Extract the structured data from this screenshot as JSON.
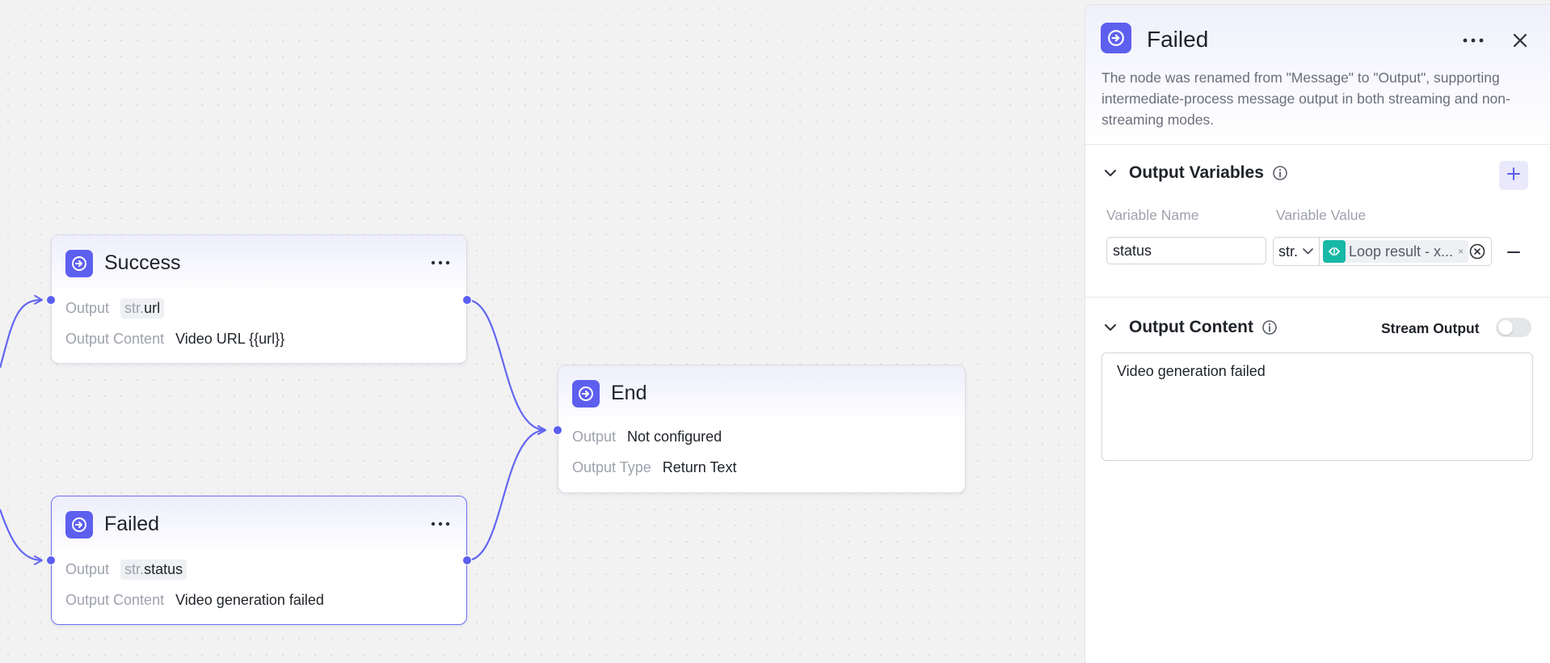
{
  "nodes": {
    "success": {
      "title": "Success",
      "output_label": "Output",
      "output_tag_prefix": "str.",
      "output_tag_name": "url",
      "content_label": "Output Content",
      "content_value": "Video URL {{url}}"
    },
    "failed": {
      "title": "Failed",
      "output_label": "Output",
      "output_tag_prefix": "str.",
      "output_tag_name": "status",
      "content_label": "Output Content",
      "content_value": "Video generation failed"
    },
    "end": {
      "title": "End",
      "output_label": "Output",
      "output_value": "Not configured",
      "type_label": "Output Type",
      "type_value": "Return Text"
    }
  },
  "panel": {
    "title": "Failed",
    "description": "The node was renamed from \"Message\" to \"Output\", supporting intermediate-process message output in both streaming and non-streaming modes.",
    "output_variables": {
      "heading": "Output Variables",
      "col_name": "Variable Name",
      "col_value": "Variable Value",
      "rows": [
        {
          "name": "status",
          "type": "str.",
          "ref": "Loop result - x..."
        }
      ]
    },
    "output_content": {
      "heading": "Output Content",
      "stream_label": "Stream Output",
      "stream_enabled": false,
      "text": "Video generation failed"
    }
  },
  "colors": {
    "accent": "#5d5fef",
    "edge": "#6366f1",
    "ref_icon": "#17b8a6"
  },
  "icons": [
    "output-node-icon",
    "more-icon",
    "close-icon",
    "chevron-down-icon",
    "info-icon",
    "plus-icon",
    "minus-icon",
    "clear-icon",
    "variable-ref-icon"
  ]
}
